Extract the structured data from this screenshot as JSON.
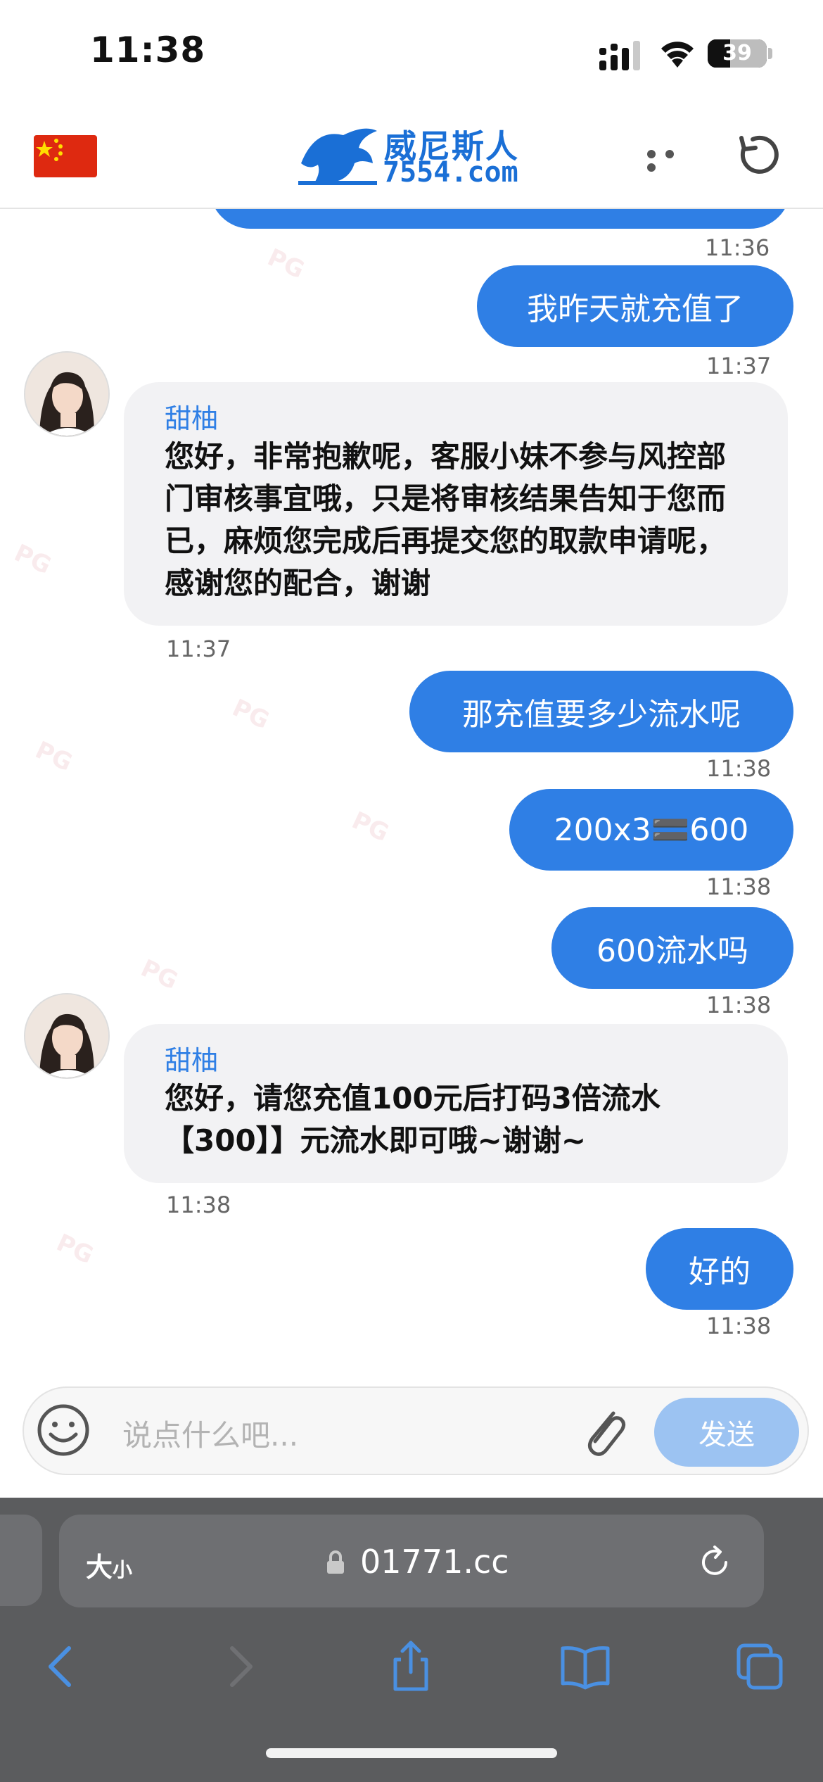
{
  "status_bar": {
    "time": "11:38",
    "battery": "39"
  },
  "header": {
    "logo_name": "威尼斯人",
    "logo_url": "7554.com"
  },
  "messages": [
    {
      "ts": "11:36"
    },
    {
      "text": "我昨天就充值了",
      "ts": "11:37"
    },
    {
      "sender": "甜柚",
      "text": "您好，非常抱歉呢，客服小妹不参与风控部门审核事宜哦，只是将审核结果告知于您而已，麻烦您完成后再提交您的取款申请呢，感谢您的配合，谢谢",
      "ts": "11:37"
    },
    {
      "text": "那充值要多少流水呢",
      "ts": "11:38"
    },
    {
      "text": "200x3🟰600",
      "ts": "11:38"
    },
    {
      "text": "600流水吗",
      "ts": "11:38"
    },
    {
      "sender": "甜柚",
      "text": "您好，请您充值100元后打码3倍流水【300】】元流水即可哦~谢谢~",
      "ts": "11:38"
    },
    {
      "text": "好的",
      "ts": "11:38"
    }
  ],
  "input": {
    "placeholder": "说点什么吧...",
    "send_label": "发送"
  },
  "browser": {
    "text_size_label": "大",
    "text_size_small": "小",
    "url": "01771.cc"
  },
  "colors": {
    "accent": "#2f7fe5",
    "send_disabled": "#9cc3f2",
    "incoming_bubble": "#f2f2f4"
  }
}
